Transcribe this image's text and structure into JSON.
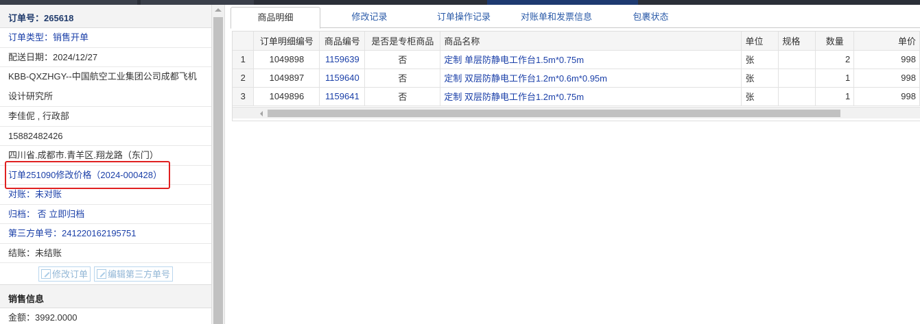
{
  "order": {
    "number_label": "订单号：265618",
    "type_label": "订单类型：",
    "type_value": "销售开单",
    "delivery_date": "配送日期：2024/12/27",
    "customer_line1": "KBB-QXZHGY--中国航空工业集团公司成都飞机",
    "customer_line2": "设计研究所",
    "contact": "李佳伲 , 行政部",
    "phone": "15882482426",
    "address": "四川省.成都市.青羊区.翔龙路（东门）",
    "modify_note": "订单251090修改价格（2024-000428）",
    "reconcile_label": "对账：",
    "reconcile_value": "未对账",
    "archive_label": "归档：",
    "archive_value": "否",
    "archive_action": "立即归档",
    "third_party_label": "第三方单号：",
    "third_party_value": "241220162195751",
    "settle": "结账：未结账",
    "modify_button": "修改订单",
    "edit_third_button": "编辑第三方单号"
  },
  "sales": {
    "header": "销售信息",
    "amount": "金额：3992.0000"
  },
  "tabs": [
    {
      "label": "商品明细",
      "active": true
    },
    {
      "label": "修改记录",
      "active": false
    },
    {
      "label": "订单操作记录",
      "active": false
    },
    {
      "label": "对账单和发票信息",
      "active": false
    },
    {
      "label": "包裹状态",
      "active": false
    }
  ],
  "table": {
    "columns": [
      "",
      "订单明细编号",
      "商品编号",
      "是否是专柜商品",
      "商品名称",
      "单位",
      "规格",
      "数量",
      "单价"
    ],
    "rows": [
      {
        "idx": "1",
        "detail_id": "1049898",
        "product_id": "1159639",
        "counter": "否",
        "name": "定制 单层防静电工作台1.5m*0.75m",
        "unit": "张",
        "spec": "",
        "qty": "2",
        "price": "998"
      },
      {
        "idx": "2",
        "detail_id": "1049897",
        "product_id": "1159640",
        "counter": "否",
        "name": "定制 双层防静电工作台1.2m*0.6m*0.95m",
        "unit": "张",
        "spec": "",
        "qty": "1",
        "price": "998"
      },
      {
        "idx": "3",
        "detail_id": "1049896",
        "product_id": "1159641",
        "counter": "否",
        "name": "定制 双层防静电工作台1.2m*0.75m",
        "unit": "张",
        "spec": "",
        "qty": "1",
        "price": "998"
      }
    ]
  },
  "colors": {
    "link": "#1a3fa8",
    "highlight": "#e02020",
    "topbar": "#2b2f38"
  }
}
